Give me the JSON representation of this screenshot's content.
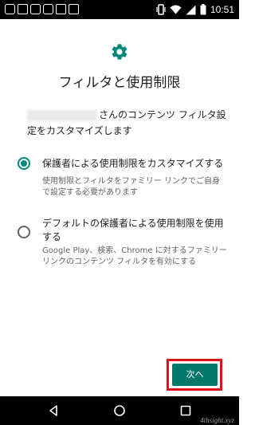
{
  "status_bar": {
    "time": "10:51",
    "left_icons": [
      "notification-icon",
      "image-icon",
      "notification-icon",
      "app-icon",
      "image-icon",
      "storage-icon"
    ],
    "right_icons": [
      "vibrate-icon",
      "wifi-icon",
      "signal-icon",
      "battery-icon"
    ]
  },
  "header": {
    "icon": "gear-icon",
    "title": "フィルタと使用制限"
  },
  "description": {
    "line1": "さんのコンテンツ フィルタ設",
    "line2": "定をカスタマイズします"
  },
  "options": [
    {
      "selected": true,
      "title": "保護者による使用制限をカスタマイズする",
      "desc_line1": "使用制限とフィルタをファミリー リンクでご自身",
      "desc_line2": "で設定する必要があります"
    },
    {
      "selected": false,
      "title_line1": "デフォルトの保護者による使用制限を使用",
      "title_line2": "する",
      "desc_line1": "Google Play、検索、Chrome に対するファミリー",
      "desc_line2": "リンクのコンテンツ フィルタを有効にする"
    }
  ],
  "next_button": {
    "label": "次へ"
  },
  "watermark": "4thsight.xyz",
  "colors": {
    "accent": "#00897b",
    "button": "#00796b",
    "highlight": "#e0101b"
  }
}
